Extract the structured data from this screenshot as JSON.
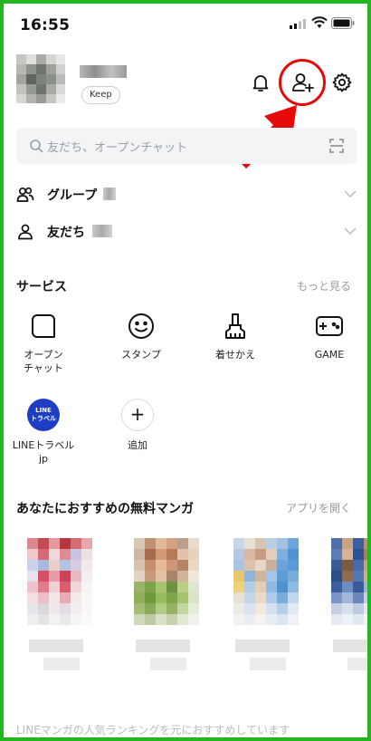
{
  "status_bar": {
    "time": "16:55"
  },
  "profile": {
    "keep_label": "Keep"
  },
  "search": {
    "placeholder": "友だち、オープンチャット"
  },
  "friends": {
    "rows": [
      {
        "label": "グループ",
        "icon": "group-icon"
      },
      {
        "label": "友だち",
        "icon": "person-icon"
      }
    ]
  },
  "services": {
    "title": "サービス",
    "more": "もっと見る",
    "items": [
      {
        "label": "オープン\nチャット",
        "icon": "openchat-icon"
      },
      {
        "label": "スタンプ",
        "icon": "sticker-icon"
      },
      {
        "label": "着せかえ",
        "icon": "theme-brush-icon"
      },
      {
        "label": "GAME",
        "icon": "game-icon"
      },
      {
        "label": "LINEトラベル\njp",
        "icon": "line-travel-icon",
        "icon_text": "LINE\nトラベル"
      },
      {
        "label": "追加",
        "icon": "add-icon"
      }
    ]
  },
  "manga": {
    "title": "あなたにおすすめの無料マンガ",
    "link": "アプリを開く",
    "footer": "LINEマンガの人気ランキングを元におすすめしています"
  },
  "colors": {
    "frame": "#22b71e",
    "annotation": "#e40a0a",
    "line_travel": "#1d3ec3"
  }
}
